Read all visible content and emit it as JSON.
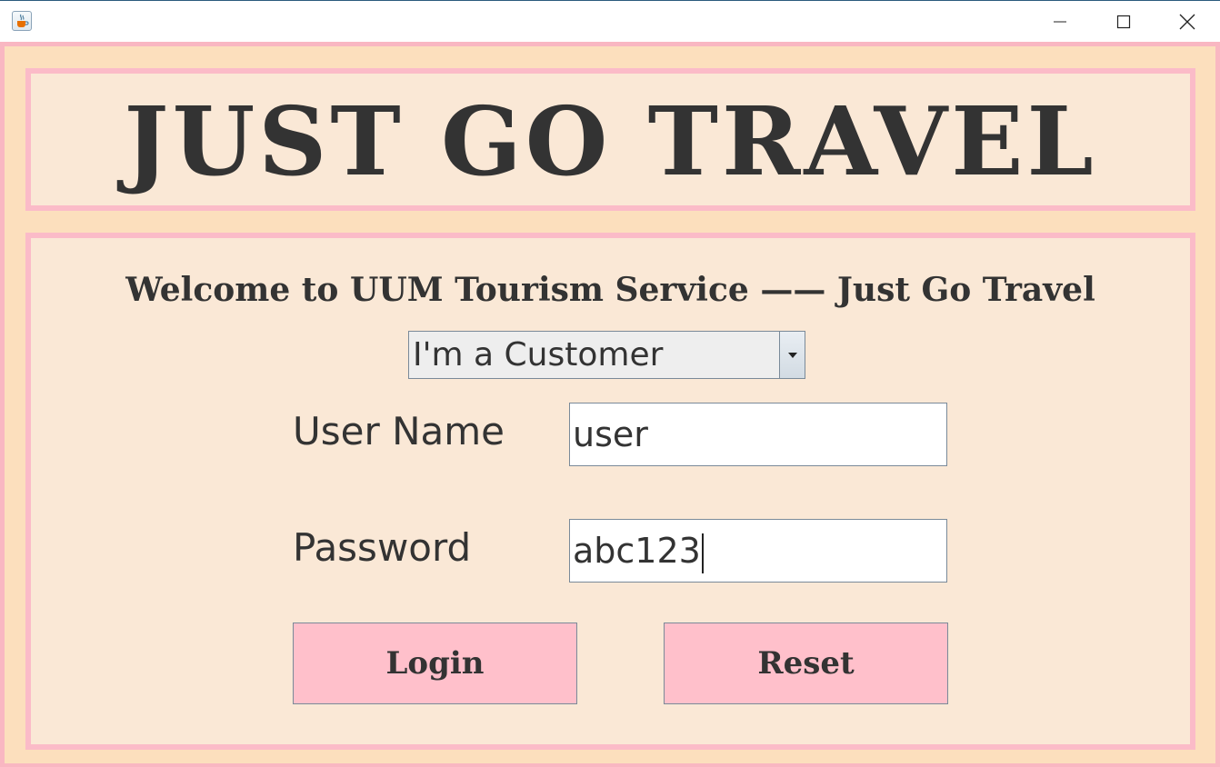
{
  "window": {
    "icons": {
      "app": "java-coffee-cup-icon",
      "minimize": "minimize-icon",
      "maximize": "maximize-icon",
      "close": "close-icon"
    }
  },
  "banner": {
    "title": "JUST GO TRAVEL"
  },
  "login": {
    "welcome_text": "Welcome to UUM Tourism Service —— Just Go Travel",
    "role_select": {
      "selected": "I'm a Customer"
    },
    "username_label": "User Name",
    "username_value": "user",
    "password_label": "Password",
    "password_value": "abc123",
    "login_label": "Login",
    "reset_label": "Reset"
  },
  "colors": {
    "outer_background": "#fcdfbd",
    "panel_background": "#fae8d6",
    "border_pink": "#fbbbc8",
    "button_pink": "#ffc0cb",
    "text_dark": "#333333"
  }
}
